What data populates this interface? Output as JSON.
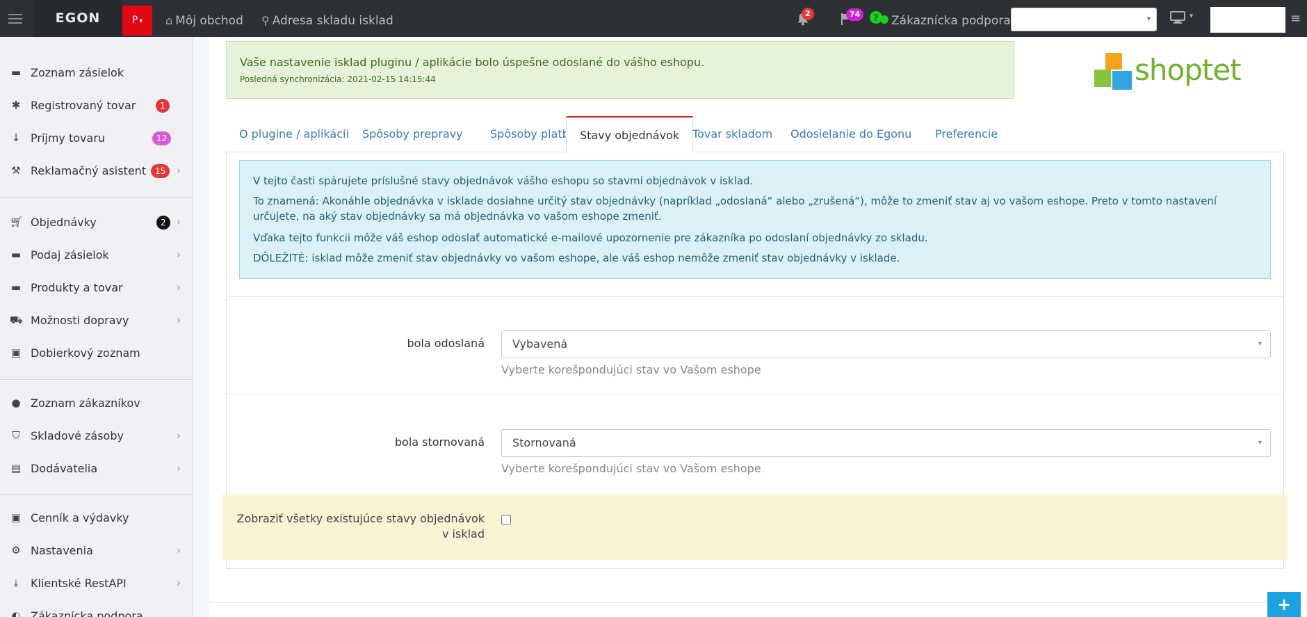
{
  "topbar": {
    "brand": "EGON",
    "p_label": "P",
    "p_caret": "▾",
    "my_shop": "Môj obchod",
    "warehouse_address": "Adresa skladu isklad",
    "notifications_count": "2",
    "messages_count": "74",
    "support": "Zákaznícka podpora",
    "select_caret": "▾",
    "monitor_caret": "▾"
  },
  "sidebar": {
    "items": [
      {
        "label": "Zoznam zásielok"
      },
      {
        "label": "Registrovaný tovar",
        "badge": "1",
        "badge_color": "#e2383b"
      },
      {
        "label": "Príjmy tovaru",
        "badge": "12",
        "badge_color": "#d75bd6"
      },
      {
        "label": "Reklamačný asistent",
        "badge": "15",
        "badge_color": "#e2383b"
      },
      {
        "label": "Objednávky",
        "badge": "2",
        "badge_color": "#111111"
      },
      {
        "label": "Podaj zásielok"
      },
      {
        "label": "Produkty a tovar"
      },
      {
        "label": "Možnosti dopravy"
      },
      {
        "label": "Dobierkový zoznam"
      },
      {
        "label": "Zoznam zákazníkov"
      },
      {
        "label": "Skladové zásoby"
      },
      {
        "label": "Dodávatelia"
      },
      {
        "label": "Cenník a výdavky"
      },
      {
        "label": "Nastavenia"
      },
      {
        "label": "Klientské RestAPI"
      },
      {
        "label": "Zákaznícka podpora"
      }
    ]
  },
  "alert": {
    "message": "Vaše nastavenie isklad pluginu / aplikácie bolo úspešne odoslané do vášho eshopu.",
    "sync": "Posledná synchronizácia: 2021-02-15 14:15:44"
  },
  "logo_text": "shoptet",
  "tabs": [
    {
      "label": "O plugine / aplikácii"
    },
    {
      "label": "Spôsoby prepravy"
    },
    {
      "label": "Spôsoby platby"
    },
    {
      "label": "Stavy objednávok"
    },
    {
      "label": "Tovar skladom"
    },
    {
      "label": "Odosielanie do Egonu"
    },
    {
      "label": "Preferencie"
    }
  ],
  "info": {
    "p1": "V tejto časti spárujete príslušné stavy objednávok vášho eshopu so stavmi objednávok v isklad.",
    "p2": "To znamená: Akonáhle objednávka v isklade dosiahne určitý stav objednávky (napríklad „odoslaná“ alebo „zrušená“), môže to zmeniť stav aj vo vašom eshope. Preto v tomto nastavení určujete, na aký stav objednávky sa má objednávka vo vašom eshope zmeniť.",
    "p3": "Vďaka tejto funkcii môže váš eshop odoslať automatické e-mailové upozornenie pre zákazníka po odoslaní objednávky zo skladu.",
    "p4": "DÔLEŽITÉ: isklad môže zmeniť stav objednávky vo vašom eshope, ale váš eshop nemôže zmeniť stav objednávky v isklade."
  },
  "form": {
    "sent_label": "bola odoslaná",
    "sent_value": "Vybavená",
    "cancel_label": "bola stornovaná",
    "cancel_value": "Stornovaná",
    "help": "Vyberte korešpondujúci stav vo Vašom eshope",
    "show_all_label": "Zobraziť všetky existujúce stavy objednávok v isklad",
    "caret": "▾"
  },
  "fab_label": "+"
}
